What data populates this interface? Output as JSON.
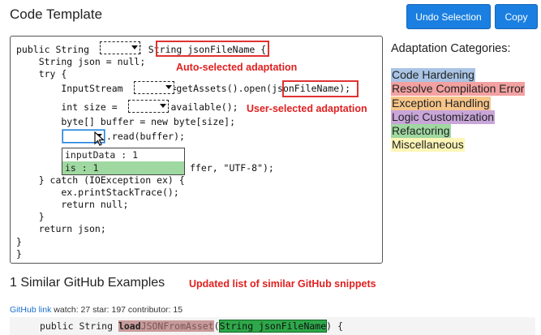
{
  "header": {
    "title": "Code Template"
  },
  "toolbar": {
    "undo_label": "Undo Selection",
    "copy_label": "Copy"
  },
  "code": {
    "line1_a": "public String ",
    "line1_b": "( ",
    "line1_param": "String jsonFileName",
    "line1_c": " {",
    "line2": "    String json = null;",
    "line3": "    try {",
    "line4_a": "        InputStream ",
    "line4_b": "=getAssets().open(",
    "line4_param": "jsonFileName",
    "line4_c": ");",
    "line5_a": "        int size = ",
    "line5_b": ".available();",
    "line6": "        byte[] buffer = new byte[size];",
    "line7_b": ".read(buffer);",
    "line8_tail": "ffer, \"UTF-8\");",
    "line10": "    } catch (IOException ex) {",
    "line11": "        ex.printStackTrace();",
    "line12": "        return null;",
    "line13": "    }",
    "line14": "    return json;",
    "line15": "}",
    "line16": "}"
  },
  "dropdown": {
    "options": [
      "inputData : 1",
      "is : 1"
    ],
    "selected_index": 1
  },
  "annotations": {
    "auto": "Auto-selected adaptation",
    "user": "User-selected adaptation",
    "similar": "Updated list of similar GitHub snippets"
  },
  "categories": {
    "title": "Adaptation Categories:",
    "items": [
      {
        "label": "Code Hardening",
        "color": "#a9c4e4"
      },
      {
        "label": "Resolve Compilation Error",
        "color": "#f3a1a1"
      },
      {
        "label": "Exception Handling",
        "color": "#f7c58a"
      },
      {
        "label": "Logic Customization",
        "color": "#c9a6d9"
      },
      {
        "label": "Refactoring",
        "color": "#9fd8a0"
      },
      {
        "label": "Miscellaneous",
        "color": "#fdf6b6"
      }
    ]
  },
  "similar": {
    "title": "1 Similar GitHub Examples",
    "link_label": "GitHub link",
    "stats": "watch: 27  star: 197  contributor: 15",
    "snippet_a": "public String ",
    "snippet_method_bold": "load",
    "snippet_method_rest": "JSONFromAsset",
    "snippet_b": "(",
    "snippet_param": "String jsonFileName",
    "snippet_c": ") {"
  },
  "colors": {
    "accent": "#1a7fe0",
    "annotation": "#e02020"
  }
}
